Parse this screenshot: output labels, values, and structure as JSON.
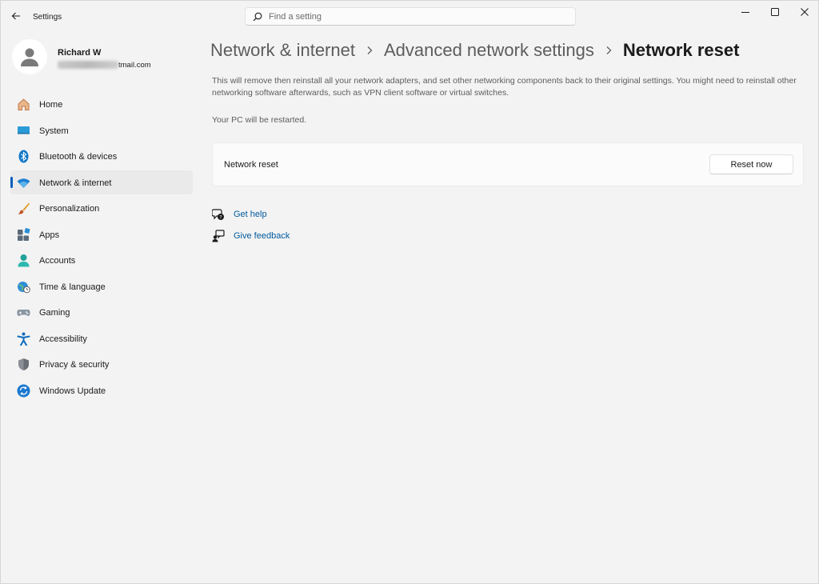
{
  "app": {
    "title": "Settings"
  },
  "search": {
    "placeholder": "Find a setting"
  },
  "user": {
    "name": "Richard W",
    "email_suffix": "tmail.com"
  },
  "sidebar": {
    "items": [
      {
        "label": "Home",
        "icon": "home-icon"
      },
      {
        "label": "System",
        "icon": "system-icon"
      },
      {
        "label": "Bluetooth & devices",
        "icon": "bluetooth-icon"
      },
      {
        "label": "Network & internet",
        "icon": "wifi-icon",
        "selected": true
      },
      {
        "label": "Personalization",
        "icon": "brush-icon"
      },
      {
        "label": "Apps",
        "icon": "apps-icon"
      },
      {
        "label": "Accounts",
        "icon": "accounts-icon"
      },
      {
        "label": "Time & language",
        "icon": "globe-clock-icon"
      },
      {
        "label": "Gaming",
        "icon": "gamepad-icon"
      },
      {
        "label": "Accessibility",
        "icon": "accessibility-icon"
      },
      {
        "label": "Privacy & security",
        "icon": "shield-icon"
      },
      {
        "label": "Windows Update",
        "icon": "update-icon"
      }
    ]
  },
  "breadcrumb": {
    "items": [
      "Network & internet",
      "Advanced network settings",
      "Network reset"
    ]
  },
  "main": {
    "description": "This will remove then reinstall all your network adapters, and set other networking components back to their original settings. You might need to reinstall other networking software afterwards, such as VPN client software or virtual switches.",
    "restart_note": "Your PC will be restarted.",
    "card_label": "Network reset",
    "reset_button": "Reset now",
    "get_help": "Get help",
    "give_feedback": "Give feedback"
  },
  "colors": {
    "accent": "#005fb8",
    "link": "#005a9e",
    "background": "#f3f3f3"
  }
}
